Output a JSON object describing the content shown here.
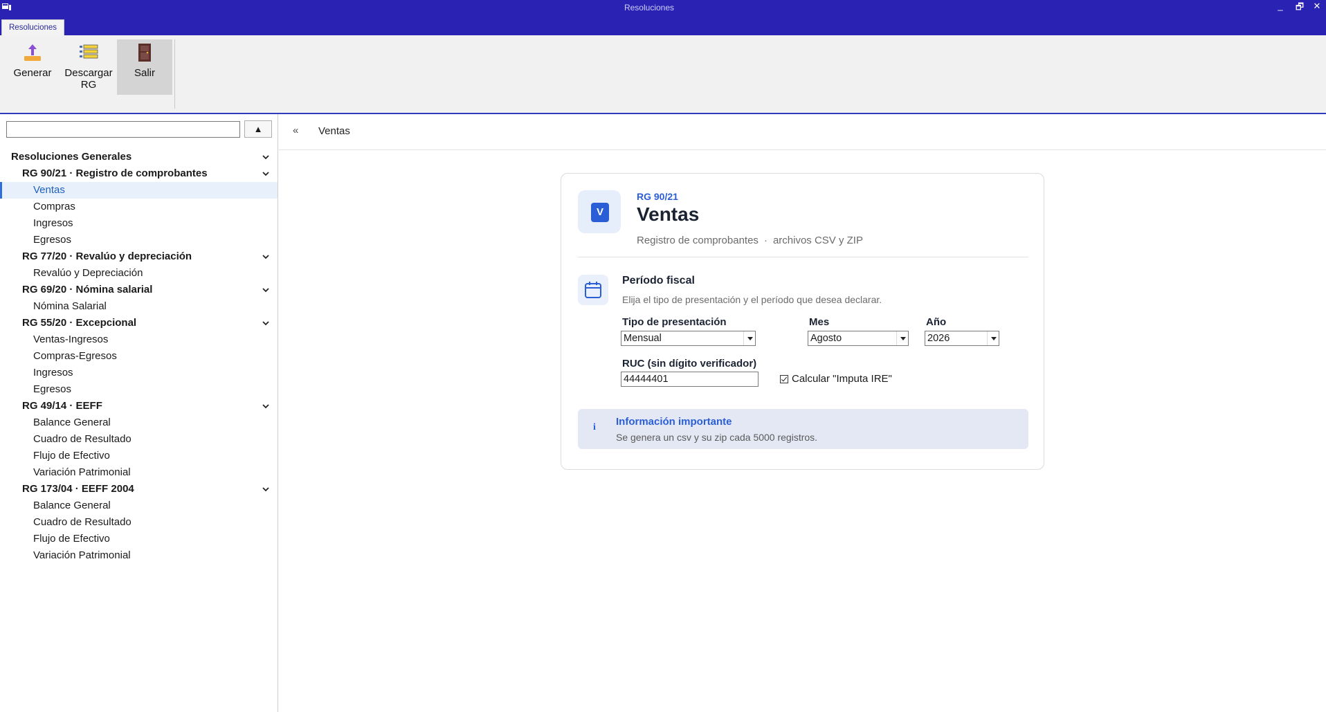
{
  "window": {
    "title": "Resoluciones",
    "minimize": "_",
    "restore": "🗗",
    "close": "✕"
  },
  "ribbon": {
    "tab": "Resoluciones",
    "buttons": [
      {
        "label": "Generar",
        "icon": "upload-icon"
      },
      {
        "label": "Descargar RG",
        "icon": "list-icon"
      },
      {
        "label": "Salir",
        "icon": "door-icon"
      }
    ]
  },
  "sidebar": {
    "search_value": "",
    "collapse_label": "▲",
    "root": "Resoluciones Generales",
    "groups": [
      {
        "label": "RG 90/21 · Registro de comprobantes",
        "items": [
          "Ventas",
          "Compras",
          "Ingresos",
          "Egresos"
        ]
      },
      {
        "label": "RG 77/20 · Revalúo y depreciación",
        "items": [
          "Revalúo y Depreciación"
        ]
      },
      {
        "label": "RG 69/20 · Nómina salarial",
        "items": [
          "Nómina Salarial"
        ]
      },
      {
        "label": "RG 55/20 · Excepcional",
        "items": [
          "Ventas-Ingresos",
          "Compras-Egresos",
          "Ingresos",
          "Egresos"
        ]
      },
      {
        "label": "RG 49/14 · EEFF",
        "items": [
          "Balance General",
          "Cuadro de Resultado",
          "Flujo de Efectivo",
          "Variación Patrimonial"
        ]
      },
      {
        "label": "RG 173/04 · EEFF 2004",
        "items": [
          "Balance General",
          "Cuadro de Resultado",
          "Flujo de Efectivo",
          "Variación Patrimonial"
        ]
      }
    ],
    "selected": "Ventas"
  },
  "breadcrumb": {
    "back": "«",
    "current": "Ventas"
  },
  "card": {
    "avatar_letter": "V",
    "rg_code": "RG 90/21",
    "title": "Ventas",
    "subtitle_a": "Registro de comprobantes",
    "subtitle_sep": "·",
    "subtitle_b": "archivos CSV y ZIP",
    "period": {
      "title": "Período fiscal",
      "description": "Elija el tipo de presentación y el período que desea declarar.",
      "tipo_label": "Tipo de presentación",
      "tipo_value": "Mensual",
      "mes_label": "Mes",
      "mes_value": "Agosto",
      "anio_label": "Año",
      "anio_value": "2026",
      "ruc_label": "RUC (sin dígito verificador)",
      "ruc_value": "44444401",
      "checkbox_label": "Calcular \"Imputa IRE\"",
      "checkbox_checked": true
    },
    "info": {
      "icon": "i",
      "title": "Información importante",
      "text": "Se genera un csv y su zip cada 5000 registros."
    }
  },
  "colors": {
    "titlebar": "#2a22b2",
    "accent": "#2a5ed6",
    "selection": "#e8f1fb"
  }
}
